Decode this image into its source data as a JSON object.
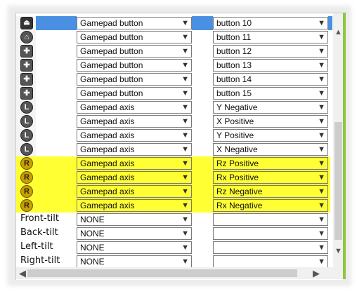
{
  "rows": [
    {
      "icon": "eject-icon",
      "glyph": "⏏",
      "kind": "eject",
      "label": "",
      "input": "Gamepad button",
      "mapping": "button 10",
      "highlight": false,
      "selected": true
    },
    {
      "icon": "home-icon",
      "glyph": "⌂",
      "kind": "ring",
      "label": "",
      "input": "Gamepad button",
      "mapping": "button 11",
      "highlight": false,
      "selected": false
    },
    {
      "icon": "dpad-up-icon",
      "glyph": "✚",
      "kind": "plus",
      "label": "",
      "input": "Gamepad button",
      "mapping": "button 12",
      "highlight": false,
      "selected": false
    },
    {
      "icon": "dpad-right-icon",
      "glyph": "✚",
      "kind": "plus",
      "label": "",
      "input": "Gamepad button",
      "mapping": "button 13",
      "highlight": false,
      "selected": false
    },
    {
      "icon": "dpad-down-icon",
      "glyph": "✚",
      "kind": "plus",
      "label": "",
      "input": "Gamepad button",
      "mapping": "button 14",
      "highlight": false,
      "selected": false
    },
    {
      "icon": "dpad-left-icon",
      "glyph": "✚",
      "kind": "plus",
      "label": "",
      "input": "Gamepad button",
      "mapping": "button 15",
      "highlight": false,
      "selected": false
    },
    {
      "icon": "left-stick-up-icon",
      "glyph": "L",
      "kind": "ring",
      "label": "",
      "input": "Gamepad axis",
      "mapping": "Y Negative",
      "highlight": false,
      "selected": false
    },
    {
      "icon": "left-stick-right-icon",
      "glyph": "L",
      "kind": "ring",
      "label": "",
      "input": "Gamepad axis",
      "mapping": "X Positive",
      "highlight": false,
      "selected": false
    },
    {
      "icon": "left-stick-down-icon",
      "glyph": "L",
      "kind": "ring",
      "label": "",
      "input": "Gamepad axis",
      "mapping": "Y Positive",
      "highlight": false,
      "selected": false
    },
    {
      "icon": "left-stick-left-icon",
      "glyph": "L",
      "kind": "ring",
      "label": "",
      "input": "Gamepad axis",
      "mapping": "X Negative",
      "highlight": false,
      "selected": false
    },
    {
      "icon": "right-stick-up-icon",
      "glyph": "R",
      "kind": "R",
      "label": "",
      "input": "Gamepad axis",
      "mapping": "Rz Positive",
      "highlight": true,
      "selected": false
    },
    {
      "icon": "right-stick-right-icon",
      "glyph": "R",
      "kind": "R",
      "label": "",
      "input": "Gamepad axis",
      "mapping": "Rx Positive",
      "highlight": true,
      "selected": false
    },
    {
      "icon": "right-stick-down-icon",
      "glyph": "R",
      "kind": "R",
      "label": "",
      "input": "Gamepad axis",
      "mapping": "Rz Negative",
      "highlight": true,
      "selected": false
    },
    {
      "icon": "right-stick-left-icon",
      "glyph": "R",
      "kind": "R",
      "label": "",
      "input": "Gamepad axis",
      "mapping": "Rx Negative",
      "highlight": true,
      "selected": false
    },
    {
      "icon": "",
      "glyph": "",
      "kind": "",
      "label": "Front-tilt",
      "input": "NONE",
      "mapping": "",
      "highlight": false,
      "selected": false
    },
    {
      "icon": "",
      "glyph": "",
      "kind": "",
      "label": "Back-tilt",
      "input": "NONE",
      "mapping": "",
      "highlight": false,
      "selected": false
    },
    {
      "icon": "",
      "glyph": "",
      "kind": "",
      "label": "Left-tilt",
      "input": "NONE",
      "mapping": "",
      "highlight": false,
      "selected": false
    },
    {
      "icon": "",
      "glyph": "",
      "kind": "",
      "label": "Right-tilt",
      "input": "NONE",
      "mapping": "",
      "highlight": false,
      "selected": false
    }
  ],
  "colors": {
    "highlight": "#ffff33",
    "selection": "#4a90e2",
    "accent": "#8dc63f"
  },
  "scroll": {
    "up": "▲",
    "down": "▼",
    "left": "◀",
    "right": "▶"
  }
}
